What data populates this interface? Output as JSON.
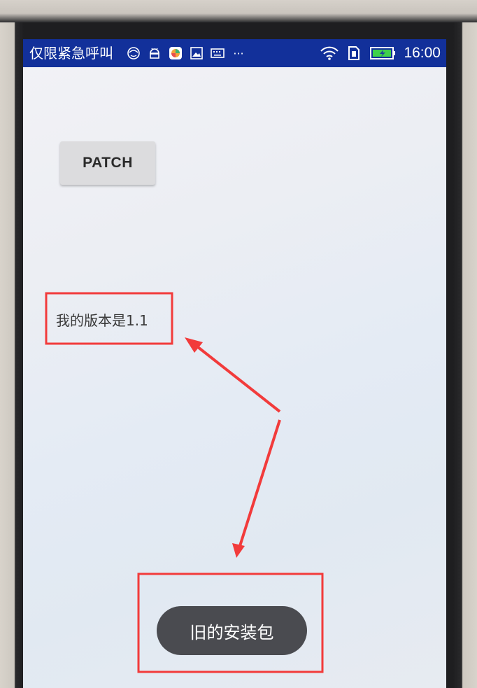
{
  "status_bar": {
    "carrier_text": "仅限紧急呼叫",
    "notification_icons": [
      "smiley-icon",
      "android-icon",
      "app-icon",
      "image-icon",
      "keyboard-icon",
      "more-icon"
    ],
    "more_glyph": "···",
    "time": "16:00",
    "right_icons": [
      "wifi-icon",
      "sim-icon",
      "battery-charging-icon"
    ]
  },
  "main": {
    "patch_button_label": "PATCH",
    "version_text": "我的版本是1.1"
  },
  "toast": {
    "message": "旧的安装包"
  },
  "colors": {
    "status_bar": "#12309a",
    "annotation_red": "#f23b3b",
    "toast_bg": "#4a4b50"
  }
}
